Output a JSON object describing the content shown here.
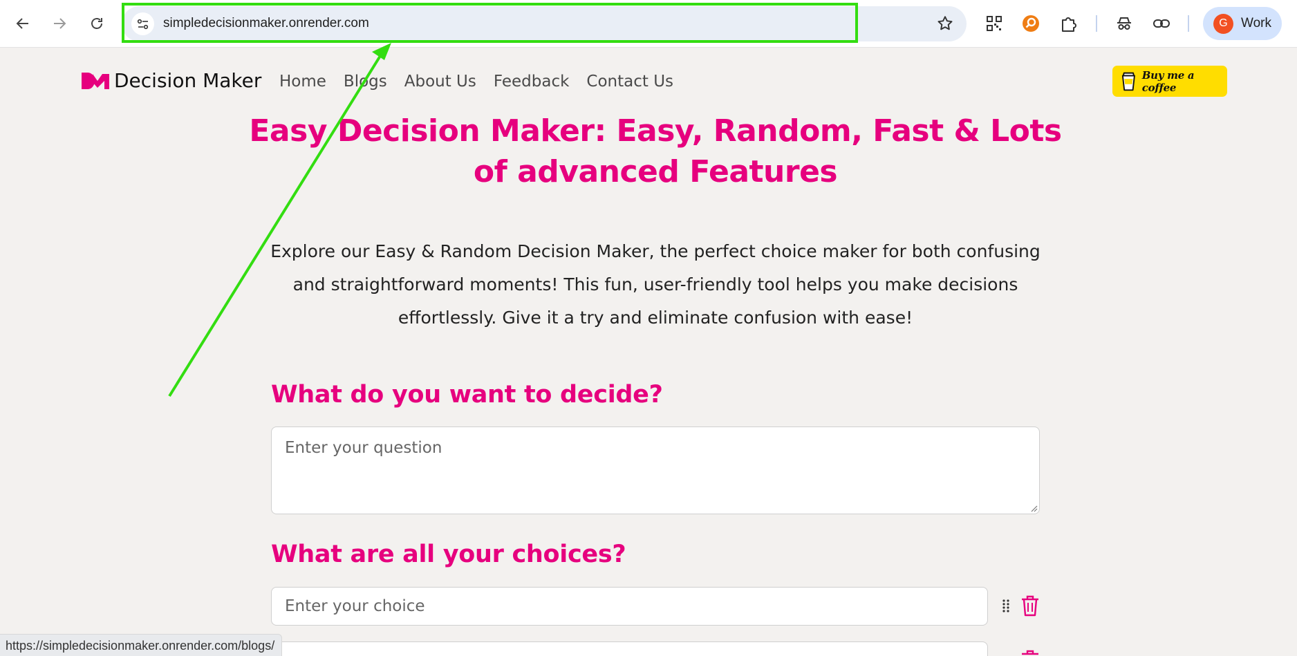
{
  "browser": {
    "url": "simpledecisionmaker.onrender.com",
    "profile_initial": "G",
    "profile_label": "Work",
    "status_url": "https://simpledecisionmaker.onrender.com/blogs/"
  },
  "site": {
    "logo_text": "Decision Maker",
    "nav": [
      "Home",
      "Blogs",
      "About Us",
      "Feedback",
      "Contact Us"
    ],
    "coffee_label": "Buy me a coffee"
  },
  "hero": {
    "title": "Easy Decision Maker: Easy, Random, Fast & Lots of advanced Features",
    "description": "Explore our Easy & Random Decision Maker, the perfect choice maker for both confusing and straightforward moments! This fun, user-friendly tool helps you make decisions effortlessly. Give it a try and eliminate confusion with ease!"
  },
  "form": {
    "question_heading": "What do you want to decide?",
    "question_placeholder": "Enter your question",
    "choices_heading": "What are all your choices?",
    "choice_placeholder": "Enter your choice"
  },
  "colors": {
    "brand_pink": "#e6007e",
    "annotation_green": "#33dd11",
    "coffee_yellow": "#ffdd00"
  }
}
